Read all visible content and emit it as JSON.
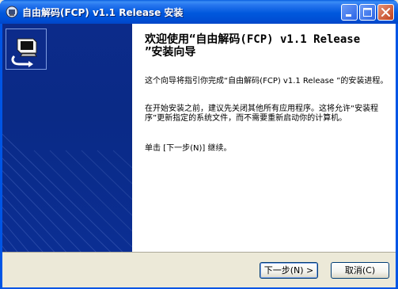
{
  "window": {
    "title": "自由解码(FCP) v1.1 Release 安装",
    "title_color": "#ffffff",
    "titlebar_color": "#0055e5"
  },
  "titlebar_buttons": {
    "minimize_icon": "minimize-icon",
    "maximize_icon": "maximize-icon",
    "close_icon": "close-icon"
  },
  "wizard": {
    "heading": "欢迎使用“自由解码(FCP) v1.1 Release ”安装向导",
    "paragraph1": "这个向导将指引你完成“自由解码(FCP) v1.1 Release ”的安装进程。",
    "paragraph2": "在开始安装之前，建议先关闭其他所有应用程序。这将允许“安装程序”更新指定的系统文件，而不需要重新启动你的计算机。",
    "paragraph3": "单击 [下一步(N)] 继续。",
    "left_panel_color": "#0c2b8a"
  },
  "buttons": {
    "next_label": "下一步(N) >",
    "cancel_label": "取消(C)"
  }
}
